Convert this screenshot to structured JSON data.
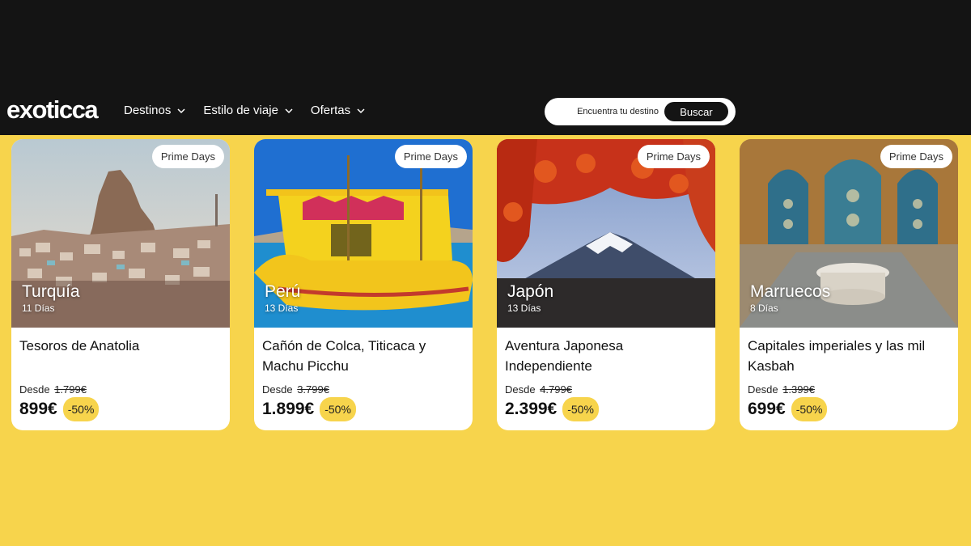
{
  "header": {
    "logo": "exoticca",
    "nav": [
      {
        "label": "Destinos"
      },
      {
        "label": "Estilo de viaje"
      },
      {
        "label": "Ofertas"
      }
    ],
    "search": {
      "placeholder": "Encuentra tu destino",
      "button": "Buscar"
    }
  },
  "cards": [
    {
      "badge": "Prime Days",
      "destination": "Turquía",
      "days": "11 Días",
      "title": "Tesoros de Anatolia",
      "from_label": "Desde",
      "old_price": "1.799€",
      "price": "899€",
      "discount": "-50%"
    },
    {
      "badge": "Prime Days",
      "destination": "Perú",
      "days": "13 Días",
      "title": "Cañón de Colca, Titicaca y Machu Picchu",
      "from_label": "Desde",
      "old_price": "3.799€",
      "price": "1.899€",
      "discount": "-50%"
    },
    {
      "badge": "Prime Days",
      "destination": "Japón",
      "days": "13 Días",
      "title": "Aventura Japonesa Independiente",
      "from_label": "Desde",
      "old_price": "4.799€",
      "price": "2.399€",
      "discount": "-50%"
    },
    {
      "badge": "Prime Days",
      "destination": "Marruecos",
      "days": "8 Días",
      "title": "Capitales imperiales y las mil Kasbah",
      "from_label": "Desde",
      "old_price": "1.399€",
      "price": "699€",
      "discount": "-50%"
    }
  ],
  "colors": {
    "accent": "#f7d44c",
    "header_bg": "#141414",
    "card_bg": "#ffffff"
  }
}
